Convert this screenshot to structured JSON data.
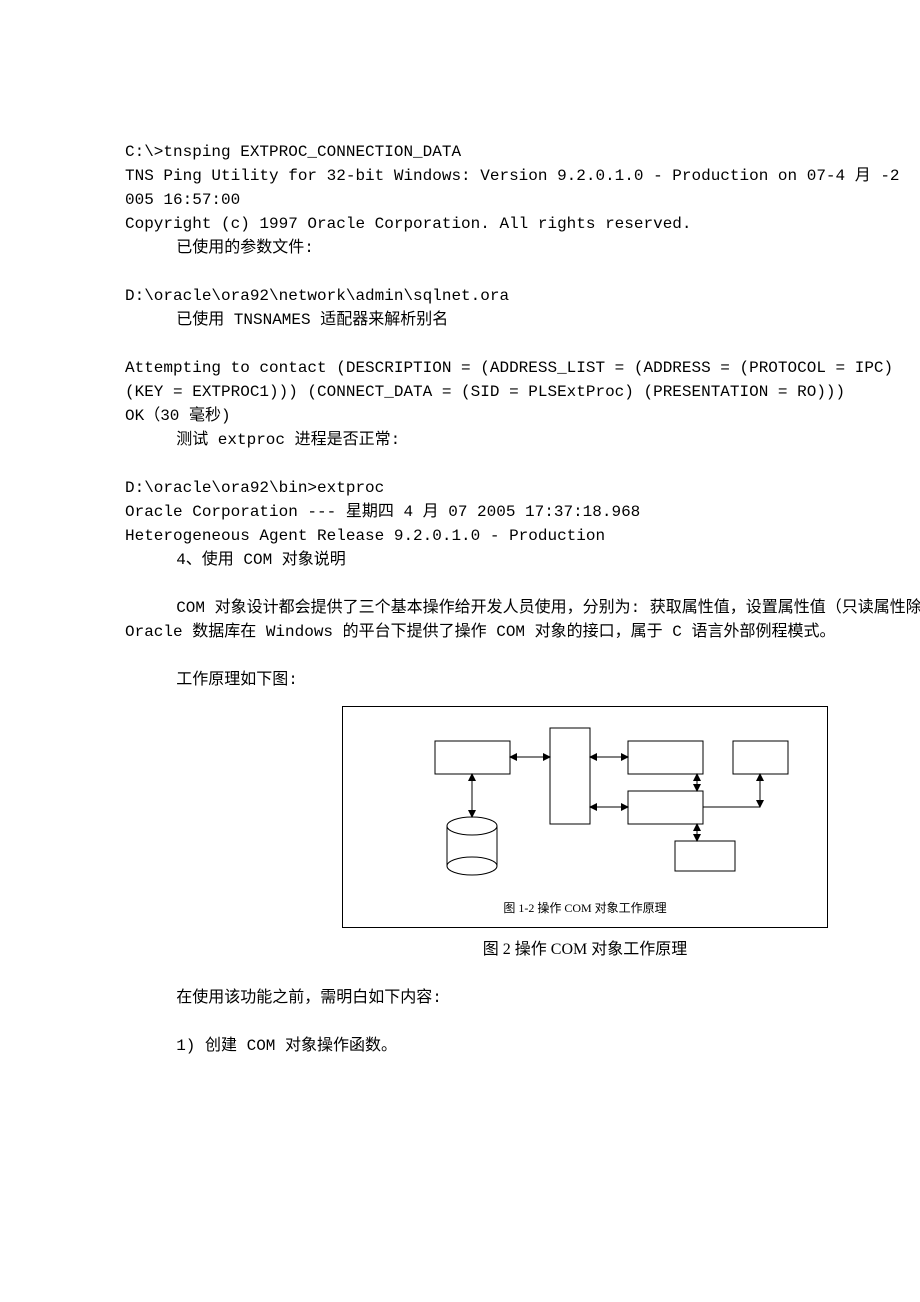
{
  "block1": {
    "l1": "C:\\>tnsping EXTPROC_CONNECTION_DATA",
    "l2": "TNS Ping Utility for 32-bit Windows: Version 9.2.0.1.0 - Production on 07-4 月 -2",
    "l3": "005 16:57:00",
    "l4": "Copyright (c) 1997 Oracle Corporation. All rights reserved.",
    "l5": "已使用的参数文件:"
  },
  "block2": {
    "l1": "D:\\oracle\\ora92\\network\\admin\\sqlnet.ora",
    "l2": "已使用 TNSNAMES 适配器来解析别名"
  },
  "block3": {
    "l1": "Attempting to contact (DESCRIPTION = (ADDRESS_LIST = (ADDRESS = (PROTOCOL = IPC)",
    "l2": "(KEY = EXTPROC1))) (CONNECT_DATA = (SID = PLSExtProc) (PRESENTATION = RO)))",
    "l3": "OK（30 毫秒)",
    "l4": "测试 extproc 进程是否正常:"
  },
  "block4": {
    "l1": "D:\\oracle\\ora92\\bin>extproc",
    "l2": "Oracle Corporation --- 星期四 4 月 07 2005 17:37:18.968",
    "l3": "Heterogeneous Agent Release 9.2.0.1.0 - Production",
    "l4": "4、使用 COM 对象说明"
  },
  "para1": "COM 对象设计都会提供了三个基本操作给开发人员使用，分别为: 获取属性值，设置属性值（只读属性除外），调用方法。Oracle 数据库在 Windows 的平台下提供了操作 COM 对象的接口，属于 C 语言外部例程模式。",
  "para2": "工作原理如下图:",
  "figure": {
    "inner_caption": "图 1-2 操作 COM 对象工作原理",
    "caption": "图 2 操作 COM 对象工作原理"
  },
  "para3": "在使用该功能之前，需明白如下内容:",
  "para4": "1) 创建 COM 对象操作函数。"
}
